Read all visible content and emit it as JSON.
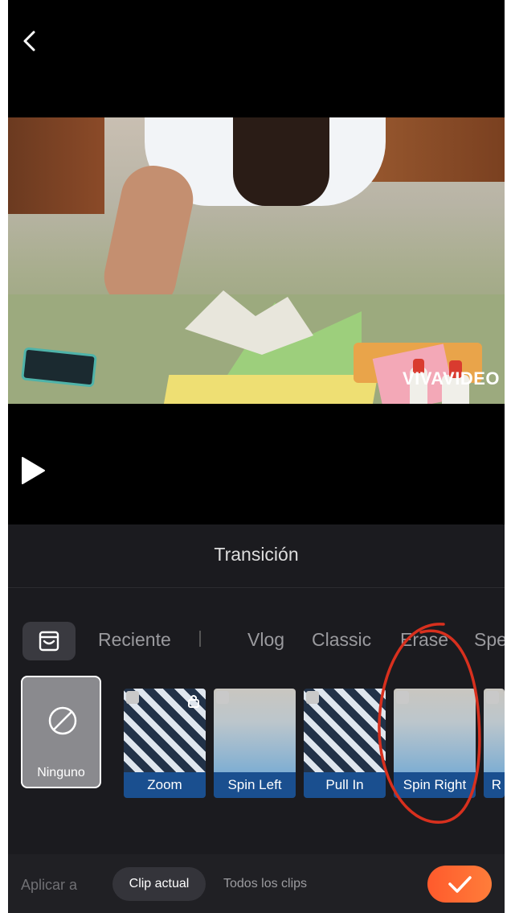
{
  "video": {
    "watermark": "VIVAVIDEO"
  },
  "panel": {
    "title": "Transición",
    "tabs": [
      "Reciente",
      "Vlog",
      "Classic",
      "Erase",
      "Spe"
    ],
    "none_label": "Ninguno",
    "transitions": [
      {
        "label": "Zoom",
        "thumb": "stripes",
        "locked": true
      },
      {
        "label": "Spin Left",
        "thumb": "sky",
        "locked": false
      },
      {
        "label": "Pull In",
        "thumb": "stripes",
        "locked": false
      },
      {
        "label": "Spin Right",
        "thumb": "sky",
        "locked": false
      },
      {
        "label": "R",
        "thumb": "sky",
        "locked": false
      }
    ]
  },
  "bottom": {
    "apply_label": "Aplicar a",
    "current_clip": "Clip actual",
    "all_clips": "Todos los clips"
  },
  "colors": {
    "accent": "#ff6a33",
    "card_caption": "#1a4f8f",
    "annotation": "#d8301e"
  }
}
